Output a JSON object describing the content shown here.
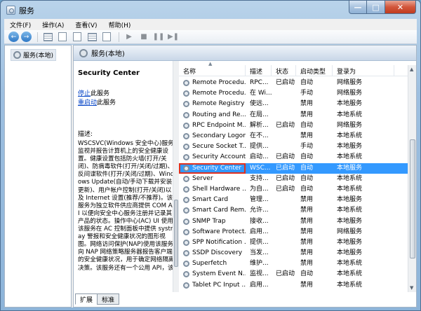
{
  "window": {
    "title": "服务"
  },
  "menu": [
    "文件(F)",
    "操作(A)",
    "查看(V)",
    "帮助(H)"
  ],
  "icons": {
    "back": "←",
    "forward": "→",
    "play": "▶",
    "stop": "■",
    "pause": "❚❚",
    "restart": "▶❚"
  },
  "tree": {
    "node": "服务(本地)"
  },
  "panel": {
    "header": "服务(本地)"
  },
  "description": {
    "title": "Security Center",
    "stop_link": "停止",
    "stop_suffix": "此服务",
    "restart_link": "重启动",
    "restart_suffix": "此服务",
    "label": "描述:",
    "text": "WSCSVC(Windows 安全中心)服务监视并报告计算机上的安全健康设置。健康设置包括防火墙(打开/关闭)、防病毒软件(打开/关闭/过期)、反间谍软件(打开/关闭/过期)、Windows Update(自动/手动下载并安装更新)、用户帐户控制(打开/关闭)以及 Internet 设置(推荐/不推荐)。该服务为独立软件供应商提供 COM API 以便向安全中心服务注册并记录其产品的状态。操作中心(AC) UI 使用该服务在 AC 控制面板中提供 systray 警报和安全健康状况的图形视图。网络访问保护(NAP)使用该服务向 NAP 网络策略服务器报告客户端的安全健康状况，用于确定网络隔离决策。该服务还有一个公用 API，该"
  },
  "columns": [
    "名称",
    "描述",
    "状态",
    "启动类型",
    "登录为"
  ],
  "services": [
    {
      "name": "Remote Procedu...",
      "desc": "RPC...",
      "status": "已启动",
      "start": "自动",
      "logon": "网络服务"
    },
    {
      "name": "Remote Procedu...",
      "desc": "在 Wi...",
      "status": "",
      "start": "手动",
      "logon": "网络服务"
    },
    {
      "name": "Remote Registry",
      "desc": "使远...",
      "status": "",
      "start": "禁用",
      "logon": "本地服务"
    },
    {
      "name": "Routing and Re...",
      "desc": "在局...",
      "status": "",
      "start": "禁用",
      "logon": "本地系统"
    },
    {
      "name": "RPC Endpoint M...",
      "desc": "解析...",
      "status": "已启动",
      "start": "自动",
      "logon": "网络服务"
    },
    {
      "name": "Secondary Logon",
      "desc": "在不...",
      "status": "",
      "start": "禁用",
      "logon": "本地系统"
    },
    {
      "name": "Secure Socket T...",
      "desc": "提供...",
      "status": "",
      "start": "手动",
      "logon": "本地服务"
    },
    {
      "name": "Security Account...",
      "desc": "启动...",
      "status": "已启动",
      "start": "自动",
      "logon": "本地系统"
    },
    {
      "name": "Security Center",
      "desc": "WSC...",
      "status": "已启动",
      "start": "自动",
      "logon": "本地服务",
      "selected": true
    },
    {
      "name": "Server",
      "desc": "支持...",
      "status": "已启动",
      "start": "自动",
      "logon": "本地系统"
    },
    {
      "name": "Shell Hardware ...",
      "desc": "为自...",
      "status": "已启动",
      "start": "自动",
      "logon": "本地系统"
    },
    {
      "name": "Smart Card",
      "desc": "管理...",
      "status": "",
      "start": "禁用",
      "logon": "本地服务"
    },
    {
      "name": "Smart Card Rem...",
      "desc": "允许...",
      "status": "",
      "start": "禁用",
      "logon": "本地系统"
    },
    {
      "name": "SNMP Trap",
      "desc": "接收...",
      "status": "",
      "start": "禁用",
      "logon": "本地服务"
    },
    {
      "name": "Software Protect...",
      "desc": "启用...",
      "status": "",
      "start": "禁用",
      "logon": "网络服务"
    },
    {
      "name": "SPP Notification ...",
      "desc": "提供...",
      "status": "",
      "start": "禁用",
      "logon": "本地服务"
    },
    {
      "name": "SSDP Discovery",
      "desc": "当发...",
      "status": "",
      "start": "禁用",
      "logon": "本地服务"
    },
    {
      "name": "Superfetch",
      "desc": "维护...",
      "status": "",
      "start": "禁用",
      "logon": "本地系统"
    },
    {
      "name": "System Event N...",
      "desc": "监视...",
      "status": "已启动",
      "start": "自动",
      "logon": "本地系统"
    },
    {
      "name": "Tablet PC Input ...",
      "desc": "启用...",
      "status": "",
      "start": "禁用",
      "logon": "本地系统"
    }
  ],
  "tabs": [
    "扩展",
    "标准"
  ]
}
